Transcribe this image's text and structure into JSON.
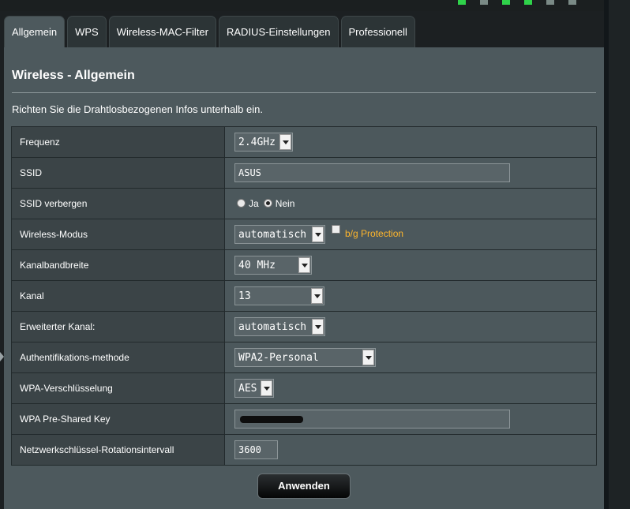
{
  "tabs": [
    {
      "label": "Allgemein",
      "active": true
    },
    {
      "label": "WPS",
      "active": false
    },
    {
      "label": "Wireless-MAC-Filter",
      "active": false
    },
    {
      "label": "RADIUS-Einstellungen",
      "active": false
    },
    {
      "label": "Professionell",
      "active": false
    }
  ],
  "panel": {
    "title": "Wireless - Allgemein",
    "description": "Richten Sie die Drahtlosbezogenen Infos unterhalb ein."
  },
  "rows": {
    "frequenz": {
      "label": "Frequenz",
      "value": "2.4GHz"
    },
    "ssid": {
      "label": "SSID",
      "value": "ASUS"
    },
    "ssid_hide": {
      "label": "SSID verbergen",
      "option_yes": "Ja",
      "option_no": "Nein",
      "selected": "Nein"
    },
    "mode": {
      "label": "Wireless-Modus",
      "value": "automatisch",
      "protection_label": "b/g Protection",
      "protection_checked": false
    },
    "bandwidth": {
      "label": "Kanalbandbreite",
      "value": "40 MHz"
    },
    "channel": {
      "label": "Kanal",
      "value": "13"
    },
    "ext_channel": {
      "label": "Erweiterter Kanal:",
      "value": "automatisch"
    },
    "auth": {
      "label": "Authentifikations-methode",
      "value": "WPA2-Personal"
    },
    "encryption": {
      "label": "WPA-Verschlüsselung",
      "value": "AES"
    },
    "psk": {
      "label": "WPA Pre-Shared Key"
    },
    "rotation": {
      "label": "Netzwerkschlüssel-Rotationsintervall",
      "value": "3600"
    }
  },
  "apply_label": "Anwenden",
  "colors": {
    "panel": "#4d595d",
    "label_cell": "#3b4447",
    "accent_orange": "#ffb62c"
  }
}
